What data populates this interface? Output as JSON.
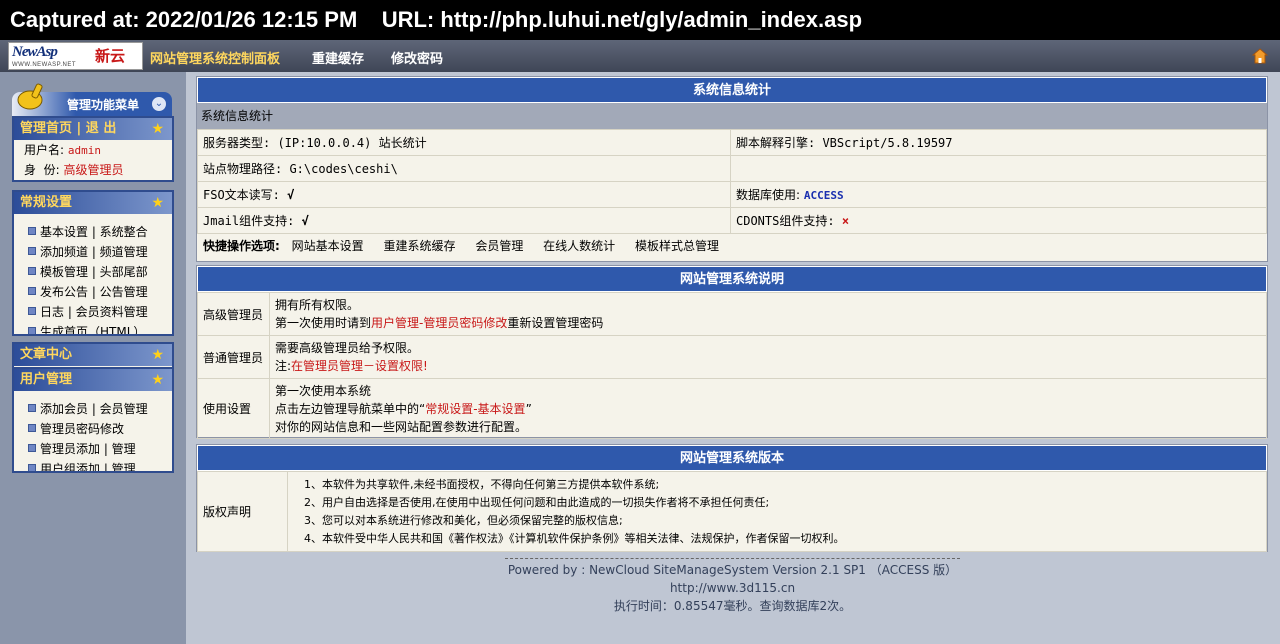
{
  "capture": {
    "text": "Captured at: 2022/01/26 12:15 PM    URL: http://php.luhui.net/gly/admin_index.asp"
  },
  "topnav": {
    "logo_main": "NewAsp",
    "logo_cn": "新云",
    "logo_url": "WWW.NEWASP.NET",
    "title": "网站管理系统控制面板",
    "links": [
      "重建缓存",
      "修改密码"
    ]
  },
  "sidebar": {
    "menu_title": "管理功能菜单",
    "home_panel": {
      "title": "管理首页 | 退 出",
      "username_label": "用户名:",
      "username": "admin",
      "role_label": "身  份:",
      "role": "高级管理员"
    },
    "general": {
      "title": "常规设置",
      "items": [
        "基本设置 | 系统整合",
        "添加频道 | 频道管理",
        "模板管理 | 头部尾部",
        "发布公告 | 公告管理",
        "日志 | 会员资料管理",
        "生成首页（HTML）"
      ]
    },
    "article": {
      "title": "文章中心"
    },
    "users": {
      "title": "用户管理",
      "items": [
        "添加会员 | 会员管理",
        "管理员密码修改",
        "管理员添加 | 管理",
        "用户组添加 | 管理"
      ]
    }
  },
  "sysinfo": {
    "header": "系统信息统计",
    "subheader": "系统信息统计",
    "server_type": "服务器类型: (IP:10.0.0.4) 站长统计",
    "script_engine": "脚本解释引擎: VBScript/5.8.19597",
    "physical_path": "站点物理路径: G:\\codes\\ceshi\\",
    "fso_label": "FSO文本读写:",
    "fso_value": "√",
    "db_label": "数据库使用:",
    "db_value": "ACCESS",
    "jmail_label": "Jmail组件支持:",
    "jmail_value": "√",
    "cdonts_label": "CDONTS组件支持:",
    "cdonts_value": "×",
    "quick_label": "快捷操作选项:",
    "quick_links": [
      "网站基本设置",
      "重建系统缓存",
      "会员管理",
      "在线人数统计",
      "模板样式总管理"
    ]
  },
  "desc": {
    "header": "网站管理系统说明",
    "rows": [
      {
        "label": "高级管理员",
        "line1": "拥有所有权限。",
        "line2_pre": "第一次使用时请到",
        "line2_red": "用户管理-管理员密码修改",
        "line2_post": "重新设置管理密码"
      },
      {
        "label": "普通管理员",
        "line1": "需要高级管理员给予权限。",
        "line2_pre": "注:",
        "line2_red": "在管理员管理－设置权限!",
        "line2_post": ""
      },
      {
        "label": "使用设置",
        "line1": "第一次使用本系统",
        "line2_pre": "点击左边管理导航菜单中的“",
        "line2_red": "常规设置-基本设置",
        "line2_post": "”",
        "line3": "对你的网站信息和一些网站配置参数进行配置。"
      }
    ]
  },
  "version": {
    "header": "网站管理系统版本",
    "label": "版权声明",
    "lines": [
      "1、本软件为共享软件,未经书面授权，不得向任何第三方提供本软件系统;",
      "2、用户自由选择是否使用,在使用中出现任何问题和由此造成的一切损失作者将不承担任何责任;",
      "3、您可以对本系统进行修改和美化，但必须保留完整的版权信息;",
      "4、本软件受中华人民共和国《著作权法》《计算机软件保护条例》等相关法律、法规保护，作者保留一切权利。"
    ]
  },
  "footer": {
    "powered": "Powered by : NewCloud SiteManageSystem Version 2.1 SP1 （ACCESS 版）",
    "url": "http://www.3d115.cn",
    "exec": "执行时间：0.85547毫秒。查询数据库2次。"
  }
}
